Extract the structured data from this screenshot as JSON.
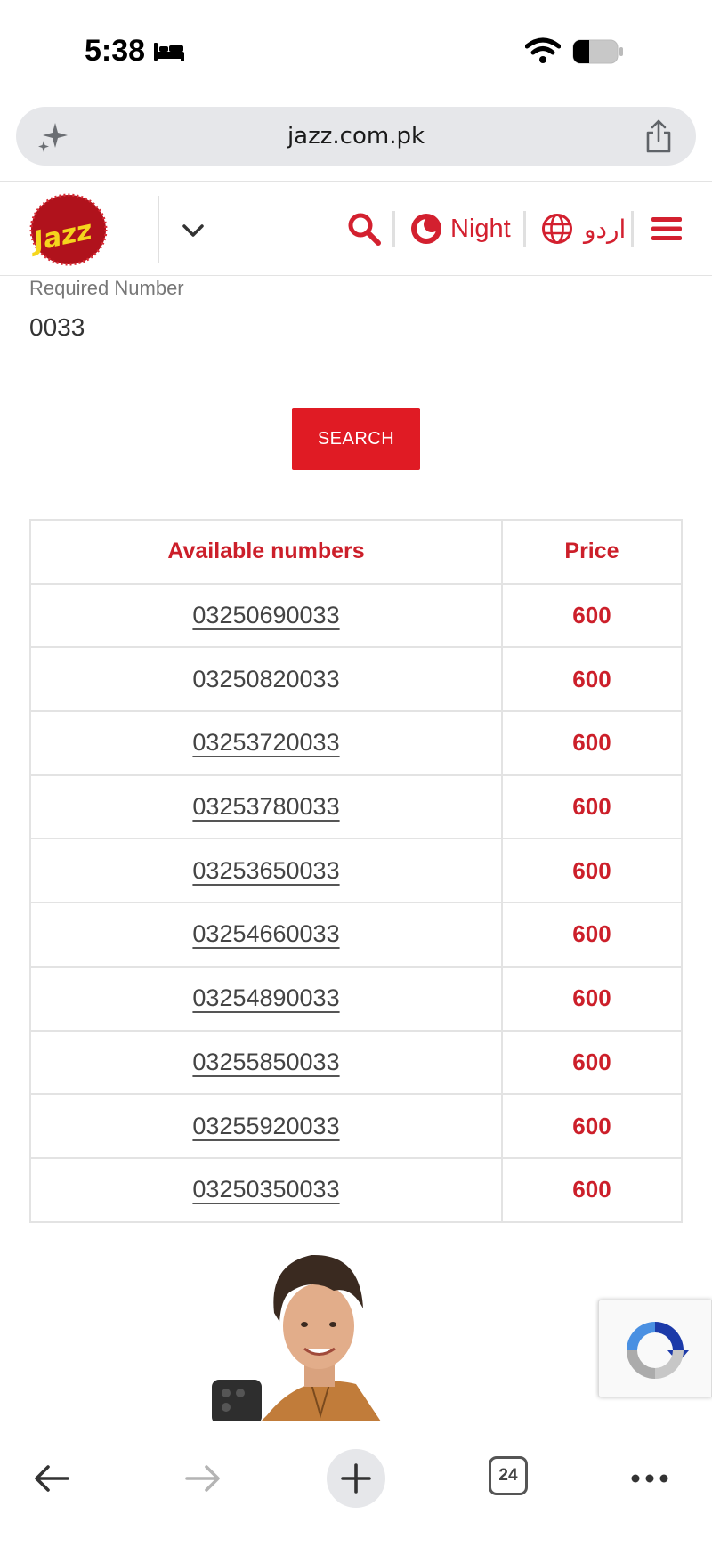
{
  "status_bar": {
    "time": "5:38"
  },
  "browser": {
    "url": "jazz.com.pk",
    "tab_count": "24"
  },
  "header": {
    "logo_text": "Jazz",
    "night_label": "Night",
    "language_label": "اردو"
  },
  "form": {
    "field_label": "Required Number",
    "field_value": "0033",
    "search_label": "SEARCH"
  },
  "table": {
    "headers": [
      "Available numbers",
      "Price"
    ],
    "rows": [
      {
        "number": "03250690033",
        "price": "600",
        "linked": true
      },
      {
        "number": "03250820033",
        "price": "600",
        "linked": false
      },
      {
        "number": "03253720033",
        "price": "600",
        "linked": true
      },
      {
        "number": "03253780033",
        "price": "600",
        "linked": true
      },
      {
        "number": "03253650033",
        "price": "600",
        "linked": true
      },
      {
        "number": "03254660033",
        "price": "600",
        "linked": true
      },
      {
        "number": "03254890033",
        "price": "600",
        "linked": true
      },
      {
        "number": "03255850033",
        "price": "600",
        "linked": true
      },
      {
        "number": "03255920033",
        "price": "600",
        "linked": true
      },
      {
        "number": "03250350033",
        "price": "600",
        "linked": true
      }
    ]
  },
  "colors": {
    "brand_red": "#d3202f",
    "button_red": "#e01b24",
    "logo_yellow": "#f5d61d"
  }
}
